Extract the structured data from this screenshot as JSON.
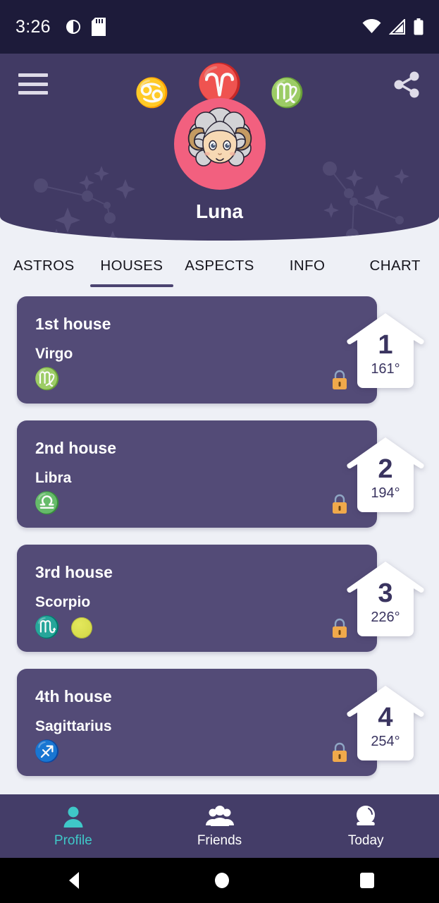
{
  "status_bar": {
    "time": "3:26",
    "left_icons": [
      "brightness-icon",
      "sd-card-icon"
    ],
    "right_icons": [
      "wifi-icon",
      "cellular-signal-icon",
      "battery-icon"
    ]
  },
  "header": {
    "menu_icon": "hamburger-menu-icon",
    "share_icon": "share-icon",
    "signs": [
      {
        "name": "Cancer",
        "glyph": "♋",
        "size": "small"
      },
      {
        "name": "Aries",
        "glyph": "♈",
        "size": "big"
      },
      {
        "name": "Virgo",
        "glyph": "♍",
        "size": "small"
      }
    ],
    "avatar": "aries-ram-avatar",
    "profile_name": "Luna",
    "bg_color": "#413a64",
    "avatar_circle_color": "#f2607f"
  },
  "tabs": {
    "items": [
      {
        "label": "ASTROS",
        "active": false
      },
      {
        "label": "HOUSES",
        "active": true
      },
      {
        "label": "ASPECTS",
        "active": false
      },
      {
        "label": "INFO",
        "active": false
      },
      {
        "label": "CHART",
        "active": false
      }
    ],
    "indicator_color": "#4a4370"
  },
  "houses": [
    {
      "title": "1st house",
      "sign": "Virgo",
      "glyph": "♍",
      "planet": null,
      "number": "1",
      "degree": "161°",
      "locked": true
    },
    {
      "title": "2nd house",
      "sign": "Libra",
      "glyph": "♎",
      "planet": null,
      "number": "2",
      "degree": "194°",
      "locked": true
    },
    {
      "title": "3rd house",
      "sign": "Scorpio",
      "glyph": "♏",
      "planet": "planet-dot-yellow",
      "number": "3",
      "degree": "226°",
      "locked": true
    },
    {
      "title": "4th house",
      "sign": "Sagittarius",
      "glyph": "♐",
      "planet": null,
      "number": "4",
      "degree": "254°",
      "locked": true
    }
  ],
  "card_colors": {
    "background": "#534b77",
    "badge_background": "#ffffff",
    "badge_text": "#3a3460",
    "lock_body": "#f0a94b",
    "lock_shackle": "#8fa6c4",
    "planet_dot": "#dcdf55"
  },
  "bottom_nav": {
    "items": [
      {
        "label": "Profile",
        "icon": "person-icon",
        "active": true
      },
      {
        "label": "Friends",
        "icon": "people-group-icon",
        "active": false
      },
      {
        "label": "Today",
        "icon": "crystal-ball-icon",
        "active": false
      }
    ],
    "active_color": "#3fc8c8",
    "background": "#443d68"
  },
  "system_nav": {
    "items": [
      {
        "name": "back-button",
        "icon": "triangle-left-icon"
      },
      {
        "name": "home-button",
        "icon": "circle-icon"
      },
      {
        "name": "recents-button",
        "icon": "square-icon"
      }
    ]
  }
}
